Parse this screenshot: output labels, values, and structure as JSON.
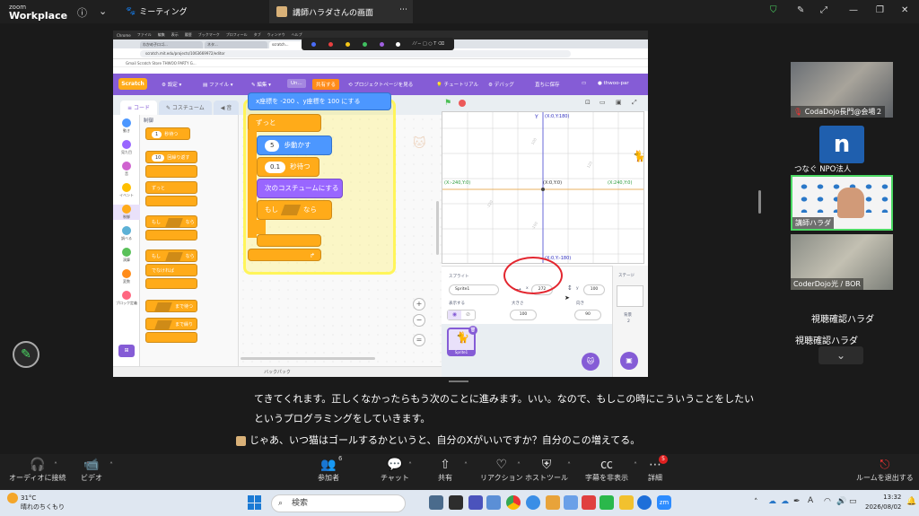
{
  "app": {
    "brand_top": "zoom",
    "brand_bottom": "Workplace"
  },
  "tabs": {
    "meeting": "ミーティング",
    "share": "講師ハラダさんの画面"
  },
  "browser": {
    "chrome_menu": [
      "Chrome",
      "ファイル",
      "編集",
      "表示",
      "履歴",
      "ブックマーク",
      "プロフィール",
      "タブ",
      "ウィンドウ",
      "ヘルプ"
    ],
    "browser_tabs": [
      "わかめ子ロゴ...",
      "ネタ...",
      "scratch..."
    ],
    "url": "scratch.mit.edu/projects/1063669972/editor",
    "bookmarks": "Gmail  Scratch  Store  THWOO PARTY G...",
    "annot_colors": [
      "#4a6cf7",
      "#e84040",
      "#f5c518",
      "#40c060",
      "#a060e0",
      "#ffffff"
    ]
  },
  "scratch": {
    "logo": "Scratch",
    "menu": {
      "settings": "設定",
      "file": "ファイル",
      "edit": "編集",
      "title": "Un...",
      "share": "共有する",
      "project_page": "プロジェクトページを見る",
      "tutorial": "チュートリアル",
      "debug": "デバッグ",
      "save": "直ちに保存",
      "user": "thwoo-par"
    },
    "pane_tabs": [
      "コード",
      "コスチューム",
      "音"
    ],
    "categories": [
      {
        "label": "動き",
        "color": "#4c97ff"
      },
      {
        "label": "見た目",
        "color": "#9966ff"
      },
      {
        "label": "音",
        "color": "#cf63cf"
      },
      {
        "label": "イベント",
        "color": "#ffbf00"
      },
      {
        "label": "制御",
        "color": "#ffab19"
      },
      {
        "label": "調べる",
        "color": "#5cb1d6"
      },
      {
        "label": "演算",
        "color": "#59c059"
      },
      {
        "label": "変数",
        "color": "#ff8c1a"
      },
      {
        "label": "ブロック定義",
        "color": "#ff6680"
      }
    ],
    "palette_heading": "制御",
    "palette_blocks": [
      "1 秒待つ",
      "10 回繰り返す",
      "ずっと",
      "もし なら",
      "もし なら",
      "でなければ",
      "まで待つ",
      "まで繰り返す"
    ],
    "code": {
      "top_block": "x座標を -200 、y座標を 100 にする",
      "forever": "ずっと",
      "move_val": "5",
      "move_label": "歩動かす",
      "wait_val": "0.1",
      "wait_label": "秒待つ",
      "next_costume": "次のコスチュームにする",
      "if_label": "もし",
      "then_label": "なら"
    },
    "backpack": "バックパック",
    "stage_labels": {
      "y_label": "Y",
      "top": "(X:0,Y:180)",
      "left": "(X:-240,Y:0)",
      "center": "(X:0,Y:0)",
      "right": "(X:240,Y:0)",
      "bottom": "(X:0,Y:-180)",
      "tick_x_pos": "120",
      "tick_x_neg": "-120",
      "tick_y_pos": "100",
      "tick_y_neg": "-100"
    },
    "sprite_panel": {
      "sprite_label": "スプライト",
      "sprite_name": "Sprite1",
      "x_label": "x",
      "x_value": "272",
      "y_label": "y",
      "y_value": "100",
      "show_label": "表示する",
      "size_label": "大きさ",
      "size_value": "100",
      "direction_label": "向き",
      "direction_value": "90",
      "thumb_name": "Sprite1"
    },
    "stage_panel": {
      "title": "ステージ",
      "backdrop_label": "背景",
      "backdrop_count": "2"
    }
  },
  "participants": [
    {
      "name": "CodaDojo長門@会場２"
    },
    {
      "name": "つなぐ NPO法人",
      "initial": "n"
    },
    {
      "name": "講師ハラダ"
    },
    {
      "name": "CoderDojo光 / BOR"
    }
  ],
  "viewing": {
    "title": "視聴確認ハラダ",
    "sub": "視聴確認ハラダ"
  },
  "captions": [
    "てきてくれます。正しくなかったらもう次のことに進みます。いい。なので、もしこの時にこういうことをしたい",
    "というプログラミングをしていきます。",
    "じゃあ、いつ猫はゴールするかというと、自分のXがいいですか？自分のこの増えてる。"
  ],
  "toolbar": {
    "audio": "オーディオに接続",
    "video": "ビデオ",
    "participants": "参加者",
    "participants_count": "6",
    "chat": "チャット",
    "share": "共有",
    "reaction": "リアクション",
    "host_tools": "ホストツール",
    "captions": "字幕を非表示",
    "more": "詳細",
    "more_badge": "5",
    "leave": "ルームを退出する"
  },
  "taskbar": {
    "temp": "31°C",
    "weather": "晴れのちくもり",
    "search": "検索",
    "time": "13:32",
    "date": "2026/08/02",
    "ime": "A"
  }
}
